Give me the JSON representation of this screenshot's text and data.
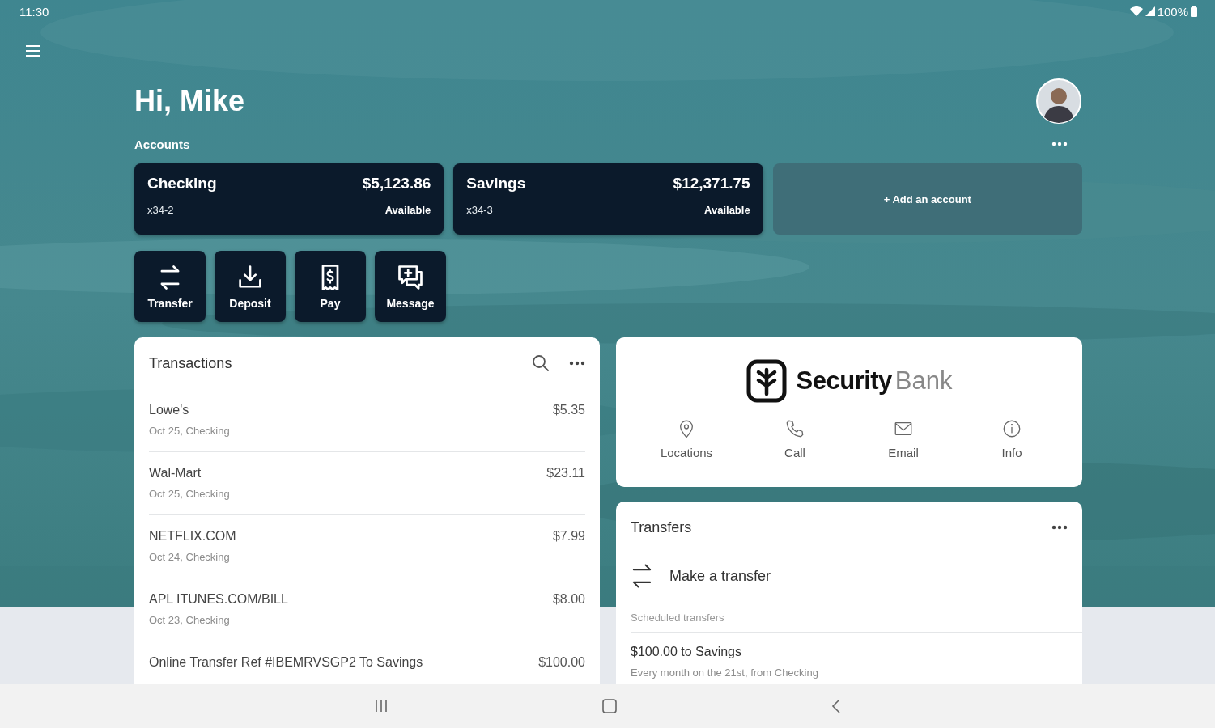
{
  "status_bar": {
    "time": "11:30",
    "battery": "100%"
  },
  "greeting": "Hi, Mike",
  "accounts": {
    "label": "Accounts",
    "items": [
      {
        "name": "Checking",
        "number": "x34-2",
        "balance": "$5,123.86",
        "balance_label": "Available"
      },
      {
        "name": "Savings",
        "number": "x34-3",
        "balance": "$12,371.75",
        "balance_label": "Available"
      }
    ],
    "add_label": "+ Add an account"
  },
  "actions": [
    {
      "label": "Transfer",
      "kind": "transfer"
    },
    {
      "label": "Deposit",
      "kind": "deposit"
    },
    {
      "label": "Pay",
      "kind": "pay"
    },
    {
      "label": "Message",
      "kind": "message"
    }
  ],
  "transactions": {
    "title": "Transactions",
    "rows": [
      {
        "name": "Lowe's",
        "detail": "Oct 25, Checking",
        "amount": "$5.35"
      },
      {
        "name": "Wal-Mart",
        "detail": "Oct 25, Checking",
        "amount": "$23.11"
      },
      {
        "name": "NETFLIX.COM",
        "detail": "Oct 24, Checking",
        "amount": "$7.99"
      },
      {
        "name": "APL ITUNES.COM/BILL",
        "detail": "Oct 23, Checking",
        "amount": "$8.00"
      },
      {
        "name": "Online Transfer Ref #IBEMRVSGP2 To Savings",
        "amount": "$100.00"
      }
    ]
  },
  "bank": {
    "name_bold": "Security",
    "name_light": "Bank",
    "links": [
      {
        "label": "Locations",
        "kind": "location"
      },
      {
        "label": "Call",
        "kind": "phone"
      },
      {
        "label": "Email",
        "kind": "mail"
      },
      {
        "label": "Info",
        "kind": "info"
      }
    ]
  },
  "transfers": {
    "title": "Transfers",
    "action": "Make a transfer",
    "section": "Scheduled transfers",
    "scheduled": [
      {
        "title": "$100.00 to Savings",
        "detail": "Every month on the 21st, from Checking"
      }
    ]
  }
}
